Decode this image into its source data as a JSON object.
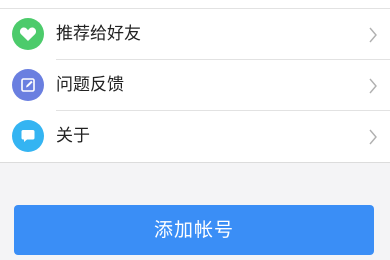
{
  "menu": {
    "items": [
      {
        "label": "推荐给好友",
        "icon": "heart-icon",
        "color": "#4ccb6b"
      },
      {
        "label": "问题反馈",
        "icon": "edit-icon",
        "color": "#6a7fe0"
      },
      {
        "label": "关于",
        "icon": "chat-bubble-icon",
        "color": "#34b4f2"
      }
    ]
  },
  "add_account_button": {
    "label": "添加帐号",
    "color": "#3a8ef6"
  }
}
